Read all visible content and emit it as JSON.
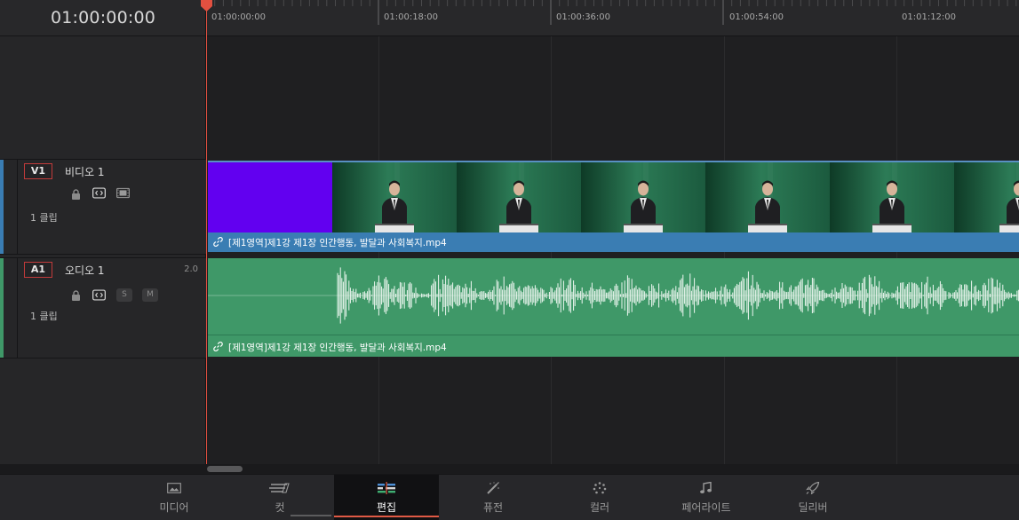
{
  "timecode": "01:00:00:00",
  "ruler": {
    "labels": [
      "01:00:00:00",
      "01:00:18:00",
      "01:00:36:00",
      "01:00:54:00",
      "01:01:12:00"
    ]
  },
  "tracks": {
    "video": {
      "tag": "V1",
      "name": "비디오 1",
      "clip_count": "1 클립",
      "color": "#3a7db3",
      "icons": [
        "lock-icon",
        "auto-select-icon",
        "film-icon"
      ]
    },
    "audio": {
      "tag": "A1",
      "name": "오디오 1",
      "format": "2.0",
      "clip_count": "1 클립",
      "color": "#3f9868",
      "solo_label": "S",
      "mute_label": "M",
      "icons": [
        "lock-icon",
        "auto-select-icon"
      ]
    }
  },
  "clips": {
    "video_clip_name": "[제1영역]제1강 제1장 인간행동, 발달과 사회복지.mp4",
    "audio_clip_name": "[제1영역]제1강 제1장 인간행동, 발달과 사회복지.mp4"
  },
  "pages": [
    {
      "label": "미디어",
      "icon": "media-icon",
      "active": false
    },
    {
      "label": "컷",
      "icon": "cut-icon",
      "active": false
    },
    {
      "label": "편집",
      "icon": "edit-icon",
      "active": true
    },
    {
      "label": "퓨전",
      "icon": "fusion-icon",
      "active": false
    },
    {
      "label": "컬러",
      "icon": "color-icon",
      "active": false
    },
    {
      "label": "페어라이트",
      "icon": "fairlight-icon",
      "active": false
    },
    {
      "label": "딜리버",
      "icon": "deliver-icon",
      "active": false
    }
  ],
  "colors": {
    "playhead": "#e25040",
    "video_track": "#3a7db3",
    "audio_track": "#3f9868",
    "active_page": "#e05a45"
  }
}
